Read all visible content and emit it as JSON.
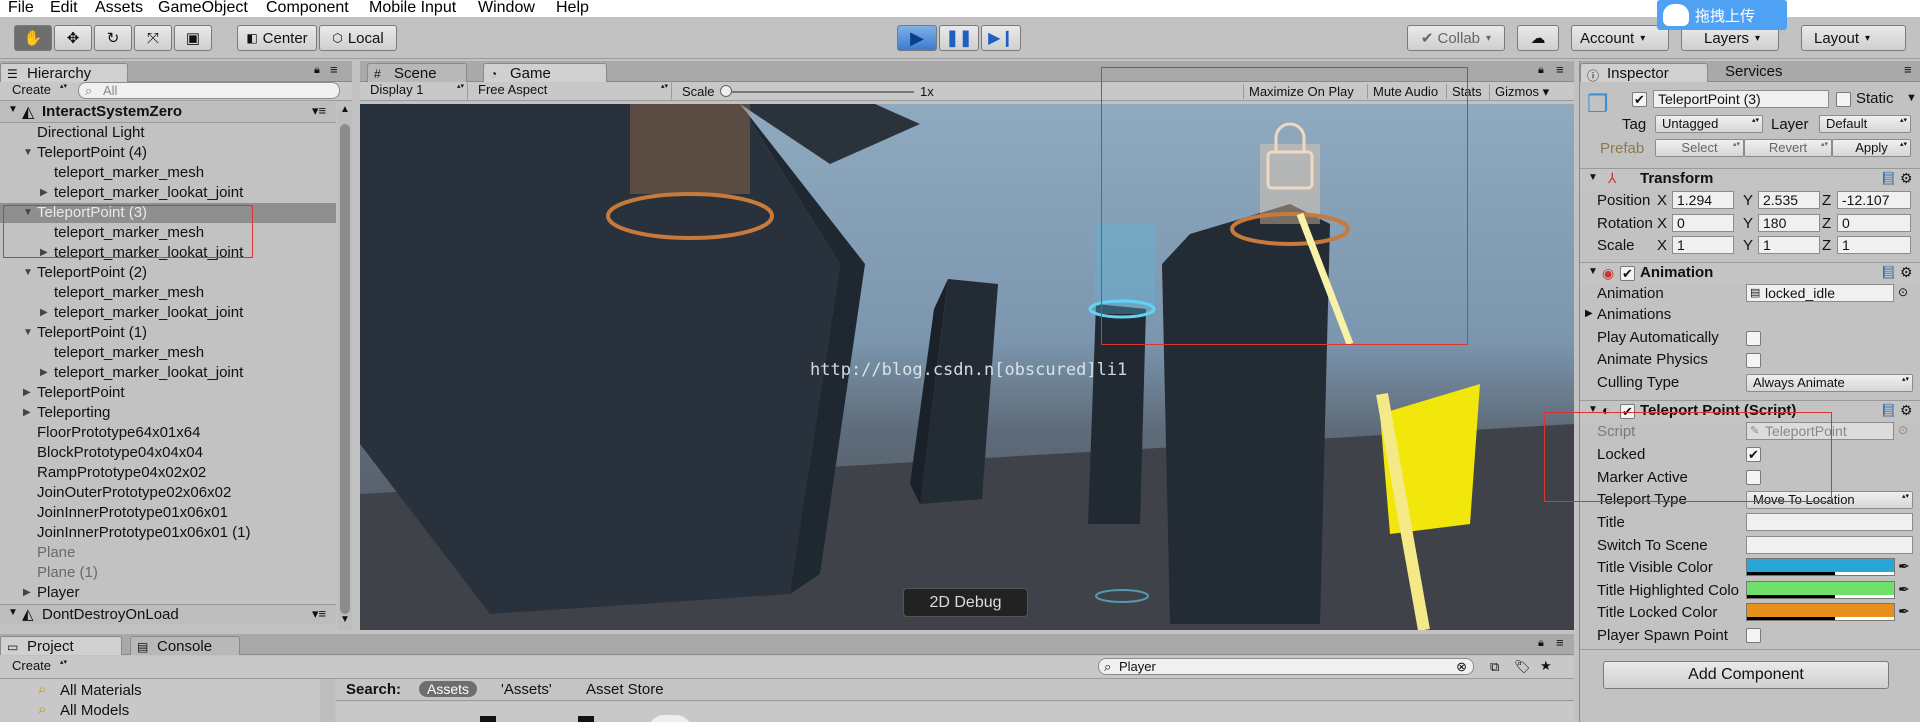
{
  "menu": [
    "File",
    "Edit",
    "Assets",
    "GameObject",
    "Component",
    "Mobile Input",
    "Window",
    "Help"
  ],
  "toolbar": {
    "center_label": "Center",
    "local_label": "Local",
    "collab_label": "Collab",
    "account_label": "Account",
    "layers_label": "Layers",
    "layout_label": "Layout",
    "upload_label": "拖拽上传"
  },
  "hierarchy": {
    "tab_label": "Hierarchy",
    "create_label": "Create",
    "search_placeholder": "All",
    "scene_name": "InteractSystemZero",
    "rows": [
      {
        "label": "Directional Light",
        "indent": 1,
        "arrow": "",
        "sel": false,
        "gray": false
      },
      {
        "label": "TeleportPoint (4)",
        "indent": 1,
        "arrow": "open",
        "sel": false,
        "gray": false
      },
      {
        "label": "teleport_marker_mesh",
        "indent": 2,
        "arrow": "",
        "sel": false,
        "gray": false
      },
      {
        "label": "teleport_marker_lookat_joint",
        "indent": 2,
        "arrow": "closed",
        "sel": false,
        "gray": false
      },
      {
        "label": "TeleportPoint (3)",
        "indent": 1,
        "arrow": "open",
        "sel": true,
        "gray": false
      },
      {
        "label": "teleport_marker_mesh",
        "indent": 2,
        "arrow": "",
        "sel": false,
        "gray": false
      },
      {
        "label": "teleport_marker_lookat_joint",
        "indent": 2,
        "arrow": "closed",
        "sel": false,
        "gray": false
      },
      {
        "label": "TeleportPoint (2)",
        "indent": 1,
        "arrow": "open",
        "sel": false,
        "gray": false
      },
      {
        "label": "teleport_marker_mesh",
        "indent": 2,
        "arrow": "",
        "sel": false,
        "gray": false
      },
      {
        "label": "teleport_marker_lookat_joint",
        "indent": 2,
        "arrow": "closed",
        "sel": false,
        "gray": false
      },
      {
        "label": "TeleportPoint (1)",
        "indent": 1,
        "arrow": "open",
        "sel": false,
        "gray": false
      },
      {
        "label": "teleport_marker_mesh",
        "indent": 2,
        "arrow": "",
        "sel": false,
        "gray": false
      },
      {
        "label": "teleport_marker_lookat_joint",
        "indent": 2,
        "arrow": "closed",
        "sel": false,
        "gray": false
      },
      {
        "label": "TeleportPoint",
        "indent": 1,
        "arrow": "closed",
        "sel": false,
        "gray": false
      },
      {
        "label": "Teleporting",
        "indent": 1,
        "arrow": "closed",
        "sel": false,
        "gray": false
      },
      {
        "label": "FloorPrototype64x01x64",
        "indent": 1,
        "arrow": "",
        "sel": false,
        "gray": false
      },
      {
        "label": "BlockPrototype04x04x04",
        "indent": 1,
        "arrow": "",
        "sel": false,
        "gray": false
      },
      {
        "label": "RampPrototype04x02x02",
        "indent": 1,
        "arrow": "",
        "sel": false,
        "gray": false
      },
      {
        "label": "JoinOuterPrototype02x06x02",
        "indent": 1,
        "arrow": "",
        "sel": false,
        "gray": false
      },
      {
        "label": "JoinInnerPrototype01x06x01",
        "indent": 1,
        "arrow": "",
        "sel": false,
        "gray": false
      },
      {
        "label": "JoinInnerPrototype01x06x01 (1)",
        "indent": 1,
        "arrow": "",
        "sel": false,
        "gray": false
      },
      {
        "label": "Plane",
        "indent": 1,
        "arrow": "",
        "sel": false,
        "gray": true
      },
      {
        "label": "Plane (1)",
        "indent": 1,
        "arrow": "",
        "sel": false,
        "gray": true
      },
      {
        "label": "Player",
        "indent": 1,
        "arrow": "closed",
        "sel": false,
        "gray": false
      }
    ],
    "dont_destroy_label": "DontDestroyOnLoad"
  },
  "game": {
    "scene_tab": "Scene",
    "game_tab": "Game",
    "display": "Display 1",
    "aspect": "Free Aspect",
    "scale_label": "Scale",
    "scale_value": "1x",
    "scale_fraction": 0.0,
    "maximize": "Maximize On Play",
    "mute": "Mute Audio",
    "stats": "Stats",
    "gizmos": "Gizmos",
    "debug_button": "2D Debug",
    "watermark": "http://blog.csdn.n[obscured]li1"
  },
  "inspector": {
    "tab_label": "Inspector",
    "services_tab": "Services",
    "object_name": "TeleportPoint (3)",
    "static_label": "Static",
    "tag_label": "Tag",
    "tag_value": "Untagged",
    "layer_label": "Layer",
    "layer_value": "Default",
    "prefab_label": "Prefab",
    "prefab_select": "Select",
    "prefab_revert": "Revert",
    "prefab_apply": "Apply",
    "transform": {
      "title": "Transform",
      "position_label": "Position",
      "position": [
        "1.294",
        "2.535",
        "-12.107"
      ],
      "rotation_label": "Rotation",
      "rotation": [
        "0",
        "180",
        "0"
      ],
      "scale_label": "Scale",
      "scale": [
        "1",
        "1",
        "1"
      ],
      "axes": [
        "X",
        "Y",
        "Z"
      ]
    },
    "animation": {
      "title": "Animation",
      "animation_label": "Animation",
      "animation_value": "locked_idle",
      "animations_label": "Animations",
      "play_auto_label": "Play Automatically",
      "animate_physics_label": "Animate Physics",
      "culling_label": "Culling Type",
      "culling_value": "Always Animate"
    },
    "teleport": {
      "title": "Teleport Point (Script)",
      "script_label": "Script",
      "script_value": "TeleportPoint",
      "locked_label": "Locked",
      "locked_checked": "✔",
      "marker_active_label": "Marker Active",
      "teleport_type_label": "Teleport Type",
      "teleport_type_value": "Move To Location",
      "title_label": "Title",
      "switch_scene_label": "Switch To Scene",
      "title_visible_color_label": "Title Visible Color",
      "title_highlighted_color_label": "Title Highlighted Colo",
      "title_locked_color_label": "Title Locked Color",
      "player_spawn_label": "Player Spawn Point",
      "colors": {
        "visible": "#2aa6d6",
        "highlighted": "#6fe06a",
        "locked": "#e8901e"
      }
    },
    "add_component": "Add Component"
  },
  "project": {
    "project_tab": "Project",
    "console_tab": "Console",
    "create_label": "Create",
    "search_value": "Player",
    "search_label": "Search:",
    "scope_assets": "Assets",
    "scope_assets_quoted": "'Assets'",
    "scope_store": "Asset Store",
    "favorites": [
      "All Materials",
      "All Models"
    ]
  }
}
